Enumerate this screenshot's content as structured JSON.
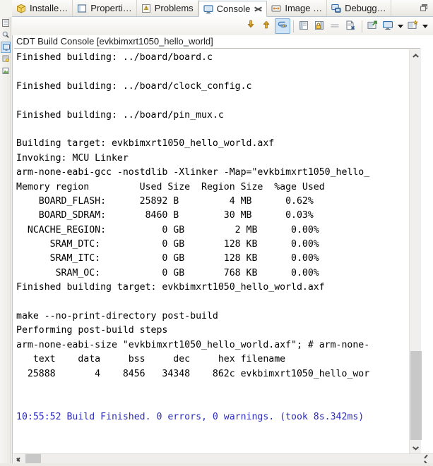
{
  "window": {
    "minimize_restore_label": "Restore"
  },
  "tabs": [
    {
      "label": "Installe…",
      "icon": "installed-sdks-icon",
      "active": false,
      "closeable": false
    },
    {
      "label": "Properti…",
      "icon": "properties-icon",
      "active": false,
      "closeable": false
    },
    {
      "label": "Problems",
      "icon": "problems-icon",
      "active": false,
      "closeable": false
    },
    {
      "label": "Console",
      "icon": "console-icon",
      "active": true,
      "closeable": true
    },
    {
      "label": "Image …",
      "icon": "image-info-icon",
      "active": false,
      "closeable": false
    },
    {
      "label": "Debugg…",
      "icon": "debugger-console-icon",
      "active": false,
      "closeable": false
    }
  ],
  "toolbar": {
    "buttons": [
      {
        "name": "scroll-lock-down-icon",
        "title": "Scroll Lock",
        "toggled": false,
        "type": "button"
      },
      {
        "name": "scroll-up-icon",
        "title": "Show Console Output",
        "toggled": false,
        "type": "button"
      },
      {
        "name": "pin-console-icon",
        "title": "Pin Console",
        "toggled": true,
        "type": "button"
      },
      {
        "name": "separator",
        "title": "",
        "toggled": false,
        "type": "separator"
      },
      {
        "name": "clear-console-icon",
        "title": "Clear Console",
        "toggled": false,
        "type": "button"
      },
      {
        "name": "lock-scroll-icon",
        "title": "Scroll Lock",
        "toggled": false,
        "type": "button"
      },
      {
        "name": "word-wrap-icon",
        "title": "Word Wrap",
        "toggled": false,
        "type": "button"
      },
      {
        "name": "remove-console-icon",
        "title": "Close Console",
        "toggled": false,
        "type": "button"
      },
      {
        "name": "separator",
        "title": "",
        "toggled": false,
        "type": "separator"
      },
      {
        "name": "open-console-icon",
        "title": "Open Console",
        "toggled": false,
        "type": "button"
      },
      {
        "name": "display-console-icon",
        "title": "Display Selected Console",
        "toggled": false,
        "type": "button"
      },
      {
        "name": "display-console-dropdown",
        "title": "Display Selected Console",
        "toggled": false,
        "type": "arrow"
      },
      {
        "name": "new-console-icon",
        "title": "New Console View",
        "toggled": false,
        "type": "button"
      },
      {
        "name": "new-console-dropdown",
        "title": "New Console View",
        "toggled": false,
        "type": "arrow"
      }
    ]
  },
  "console": {
    "title": "CDT Build Console [evkbimxrt1050_hello_world]",
    "lines": [
      {
        "text": "Finished building: ../board/board.c",
        "blue": false
      },
      {
        "text": "",
        "blue": false
      },
      {
        "text": "Finished building: ../board/clock_config.c",
        "blue": false
      },
      {
        "text": "",
        "blue": false
      },
      {
        "text": "Finished building: ../board/pin_mux.c",
        "blue": false
      },
      {
        "text": "",
        "blue": false
      },
      {
        "text": "Building target: evkbimxrt1050_hello_world.axf",
        "blue": false
      },
      {
        "text": "Invoking: MCU Linker",
        "blue": false
      },
      {
        "text": "arm-none-eabi-gcc -nostdlib -Xlinker -Map=\"evkbimxrt1050_hello_",
        "blue": false
      },
      {
        "text": "Memory region         Used Size  Region Size  %age Used",
        "blue": false
      },
      {
        "text": "    BOARD_FLASH:      25892 B         4 MB      0.62%",
        "blue": false
      },
      {
        "text": "    BOARD_SDRAM:       8460 B        30 MB      0.03%",
        "blue": false
      },
      {
        "text": "  NCACHE_REGION:          0 GB         2 MB      0.00%",
        "blue": false
      },
      {
        "text": "      SRAM_DTC:           0 GB       128 KB      0.00%",
        "blue": false
      },
      {
        "text": "      SRAM_ITC:           0 GB       128 KB      0.00%",
        "blue": false
      },
      {
        "text": "       SRAM_OC:           0 GB       768 KB      0.00%",
        "blue": false
      },
      {
        "text": "Finished building target: evkbimxrt1050_hello_world.axf",
        "blue": false
      },
      {
        "text": "",
        "blue": false
      },
      {
        "text": "make --no-print-directory post-build",
        "blue": false
      },
      {
        "text": "Performing post-build steps",
        "blue": false
      },
      {
        "text": "arm-none-eabi-size \"evkbimxrt1050_hello_world.axf\"; # arm-none-",
        "blue": false
      },
      {
        "text": "   text    data     bss     dec     hex filename",
        "blue": false
      },
      {
        "text": "  25888       4    8456   34348    862c evkbimxrt1050_hello_wor",
        "blue": false
      },
      {
        "text": "",
        "blue": false
      },
      {
        "text": "",
        "blue": false
      },
      {
        "text": "10:55:52 Build Finished. 0 errors, 0 warnings. (took 8s.342ms)",
        "blue": true
      }
    ]
  },
  "scrollbars": {
    "vertical_up": "scroll-up-arrow",
    "vertical_down": "scroll-down-arrow",
    "horizontal_left": "scroll-left-arrow",
    "horizontal_right": "scroll-right-arrow"
  },
  "fastview": {
    "items": [
      {
        "name": "fastview-item-outline",
        "selected": false
      },
      {
        "name": "fastview-item-search",
        "selected": false
      },
      {
        "name": "fastview-item-console",
        "selected": true
      },
      {
        "name": "fastview-item-registers",
        "selected": false
      },
      {
        "name": "fastview-item-memory",
        "selected": false
      }
    ]
  },
  "colors": {
    "accent_blue": "#2b2bbb",
    "toggle_highlight": "#cfe4f7",
    "tab_active_bg": "#ffffff",
    "chrome_bg": "#eceae4"
  }
}
